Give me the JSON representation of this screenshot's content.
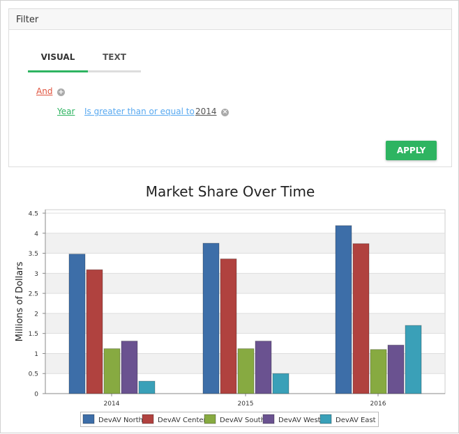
{
  "filter": {
    "title": "Filter",
    "tabs": [
      {
        "label": "VISUAL",
        "active": true
      },
      {
        "label": "TEXT",
        "active": false
      }
    ],
    "group_operator": "And",
    "condition": {
      "field": "Year",
      "operator": "Is greater than or equal to",
      "value": "2014"
    },
    "apply_label": "APPLY",
    "add_icon": "plus-circle-icon",
    "remove_icon": "x-circle-icon"
  },
  "colors": {
    "accent": "#2eb461",
    "and": "#e0533e",
    "field": "#2eb461",
    "operator": "#59a9f0"
  },
  "chart_data": {
    "type": "bar",
    "title": "Market Share Over Time",
    "xlabel": "",
    "ylabel": "Millions of Dollars",
    "ylim": [
      0,
      4.5
    ],
    "yticks": [
      "0",
      "0.5",
      "1",
      "1.5",
      "2",
      "2.5",
      "3",
      "3.5",
      "4",
      "4.5"
    ],
    "categories": [
      "2014",
      "2015",
      "2016"
    ],
    "series": [
      {
        "name": "DevAV North",
        "color": "#3d6ea8",
        "values": [
          3.48,
          3.75,
          4.19
        ]
      },
      {
        "name": "DevAV Center",
        "color": "#b0423f",
        "values": [
          3.09,
          3.36,
          3.74
        ]
      },
      {
        "name": "DevAV South",
        "color": "#87aa41",
        "values": [
          1.12,
          1.12,
          1.1
        ]
      },
      {
        "name": "DevAV West",
        "color": "#6a5290",
        "values": [
          1.31,
          1.31,
          1.21
        ]
      },
      {
        "name": "DevAV East",
        "color": "#3aa0b8",
        "values": [
          0.31,
          0.5,
          1.7
        ]
      }
    ],
    "grid": true,
    "legend": "bottom"
  }
}
